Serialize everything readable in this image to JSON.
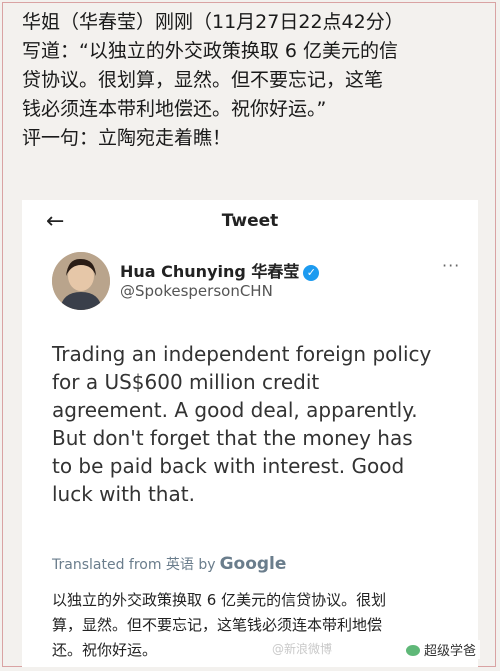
{
  "caption": {
    "line1": "华姐（华春莹）刚刚（11月27日22点42分）",
    "line2": "写道：“以独立的外交政策换取 6 亿美元的信",
    "line3": "贷协议。很划算，显然。但不要忘记，这笔",
    "line4": "钱必须连本带利地偿还。祝你好运。”",
    "line5": "评一句：立陶宛走着瞧！"
  },
  "tweet": {
    "header_title": "Tweet",
    "author_name": "Hua Chunying 华春莹",
    "handle": "@SpokespersonCHN",
    "text_lines": [
      "Trading an independent foreign policy",
      "for a US$600 million credit",
      "agreement. A good deal, apparently.",
      "But don't forget that the money has",
      "to be paid back with interest. Good",
      "luck with that."
    ],
    "translated_label": "Translated from 英语 by",
    "google_label": "Google",
    "translation_lines": [
      "以独立的外交政策换取 6 亿美元的信贷协议。很划",
      "算，显然。但不要忘记，这笔钱必须连本带利地偿",
      "还。祝你好运。"
    ]
  },
  "watermark": {
    "weibo": "@新浪微博",
    "badge": "超级学爸"
  },
  "colors": {
    "verified": "#1d9bf0",
    "translated_text": "#6a7d8c",
    "frame_border": "#d9a3a3"
  }
}
